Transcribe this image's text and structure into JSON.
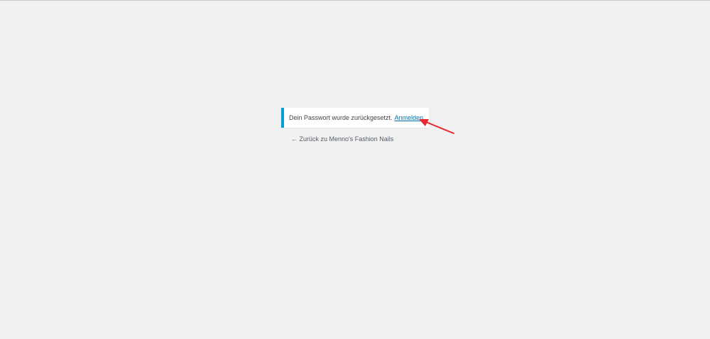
{
  "notice": {
    "message": "Dein Passwort wurde zurückgesetzt.",
    "login_link": "Anmelden",
    "accent_color": "#00a0d2",
    "link_color": "#0073aa"
  },
  "back_link": {
    "label": "← Zurück zu Menno's Fashion Nails"
  },
  "annotation": {
    "arrow_color": "#e8262b",
    "icon": "red-arrow-icon"
  },
  "page": {
    "background": "#f1f1f1"
  }
}
